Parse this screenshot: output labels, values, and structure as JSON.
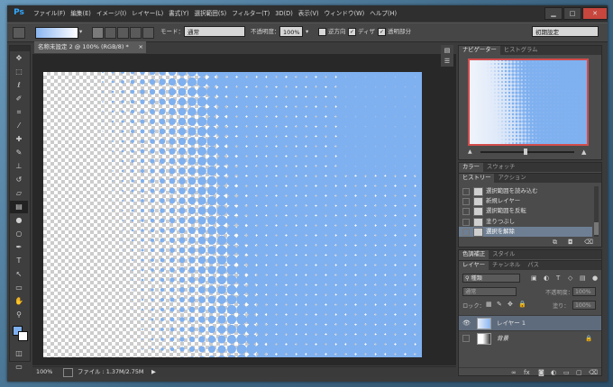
{
  "app": {
    "logo": "Ps",
    "menu": [
      "ファイル(F)",
      "編集(E)",
      "イメージ(I)",
      "レイヤー(L)",
      "書式(Y)",
      "選択範囲(S)",
      "フィルター(T)",
      "3D(D)",
      "表示(V)",
      "ウィンドウ(W)",
      "ヘルプ(H)"
    ],
    "window_controls": [
      "▁",
      "□",
      "✕"
    ]
  },
  "options": {
    "mode_label": "モード：",
    "mode_value": "通常",
    "opacity_label": "不透明度：",
    "opacity_value": "100%",
    "reverse_label": "逆方向",
    "dither_label": "ディザ",
    "transparency_label": "透明部分",
    "workspace": "初期設定"
  },
  "document": {
    "tab_title": "名称未設定 2 @ 100% (RGB/8) *",
    "zoom": "100%",
    "file_info": "ファイル : 1.37M/2.75M"
  },
  "colors": {
    "accent": "#31a8ff",
    "dot": "#7fb0ef",
    "selection_highlight": "#6e7f93",
    "navigator_frame": "#d24c4c"
  },
  "navigator": {
    "tabs": [
      "ナビゲーター",
      "ヒストグラム"
    ]
  },
  "color_panel": {
    "tabs": [
      "カラー",
      "スウォッチ"
    ]
  },
  "history": {
    "tabs": [
      "ヒストリー",
      "アクション"
    ],
    "items": [
      "選択範囲を読み込む",
      "新規レイヤー",
      "選択範囲を反転",
      "塗りつぶし",
      "選択を解除"
    ],
    "active_index": 4
  },
  "adjust_panel": {
    "tabs": [
      "色調補正",
      "スタイル"
    ]
  },
  "layers": {
    "tabs": [
      "レイヤー",
      "チャンネル",
      "パス"
    ],
    "filter_kind": "種類",
    "blend": "通常",
    "opacity_label": "不透明度：",
    "opacity_value": "100%",
    "lock_label": "ロック：",
    "fill_label": "塗り：",
    "fill_value": "100%",
    "items": [
      {
        "name": "レイヤー 1",
        "active": true
      },
      {
        "name": "背景",
        "active": false
      }
    ]
  }
}
